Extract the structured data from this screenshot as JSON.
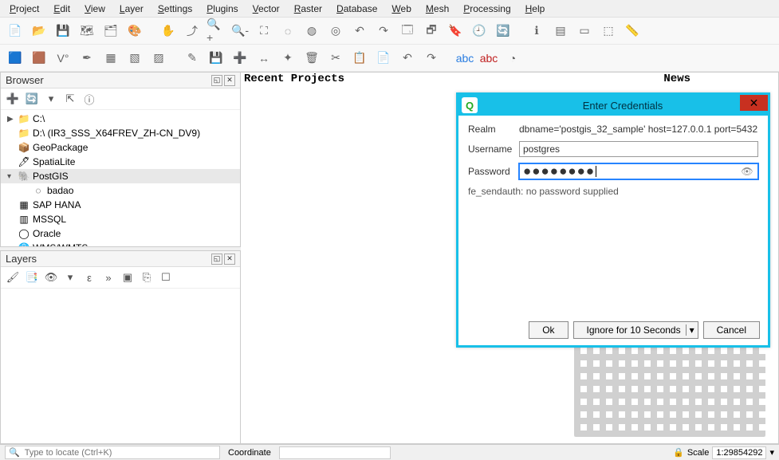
{
  "menu": [
    "Project",
    "Edit",
    "View",
    "Layer",
    "Settings",
    "Plugins",
    "Vector",
    "Raster",
    "Database",
    "Web",
    "Mesh",
    "Processing",
    "Help"
  ],
  "menu_hotkeys": [
    "P",
    "E",
    "V",
    "L",
    "S",
    "P",
    "V",
    "R",
    "D",
    "W",
    "M",
    "P",
    "H"
  ],
  "browser_panel": {
    "title": "Browser",
    "items": [
      {
        "label": "C:\\",
        "icon": "folder",
        "exp": "▶"
      },
      {
        "label": "D:\\ (IR3_SSS_X64FREV_ZH-CN_DV9)",
        "icon": "folder",
        "exp": ""
      },
      {
        "label": "GeoPackage",
        "icon": "geopackage",
        "exp": ""
      },
      {
        "label": "SpatiaLite",
        "icon": "spatialite",
        "exp": ""
      },
      {
        "label": "PostGIS",
        "icon": "postgis",
        "exp": "▾",
        "selected": true
      },
      {
        "label": "badao",
        "icon": "db-conn",
        "exp": "",
        "indent": 1
      },
      {
        "label": "SAP HANA",
        "icon": "sap",
        "exp": ""
      },
      {
        "label": "MSSQL",
        "icon": "mssql",
        "exp": ""
      },
      {
        "label": "Oracle",
        "icon": "oracle",
        "exp": ""
      },
      {
        "label": "WMS/WMTS",
        "icon": "wms",
        "exp": ""
      }
    ]
  },
  "layers_panel": {
    "title": "Layers"
  },
  "canvas": {
    "recent": "Recent Projects",
    "news": "News"
  },
  "dialog": {
    "title": "Enter Credentials",
    "realm_label": "Realm",
    "realm_value": "dbname='postgis_32_sample' host=127.0.0.1 port=5432",
    "username_label": "Username",
    "username_value": "postgres",
    "password_label": "Password",
    "password_value": "●●●●●●●●",
    "error": "fe_sendauth: no password supplied",
    "buttons": {
      "ok": "Ok",
      "ignore": "Ignore for 10 Seconds",
      "cancel": "Cancel"
    }
  },
  "status": {
    "search_placeholder": "Type to locate (Ctrl+K)",
    "coord_label": "Coordinate",
    "scale_label": "Scale",
    "scale_value": "1:29854292"
  }
}
